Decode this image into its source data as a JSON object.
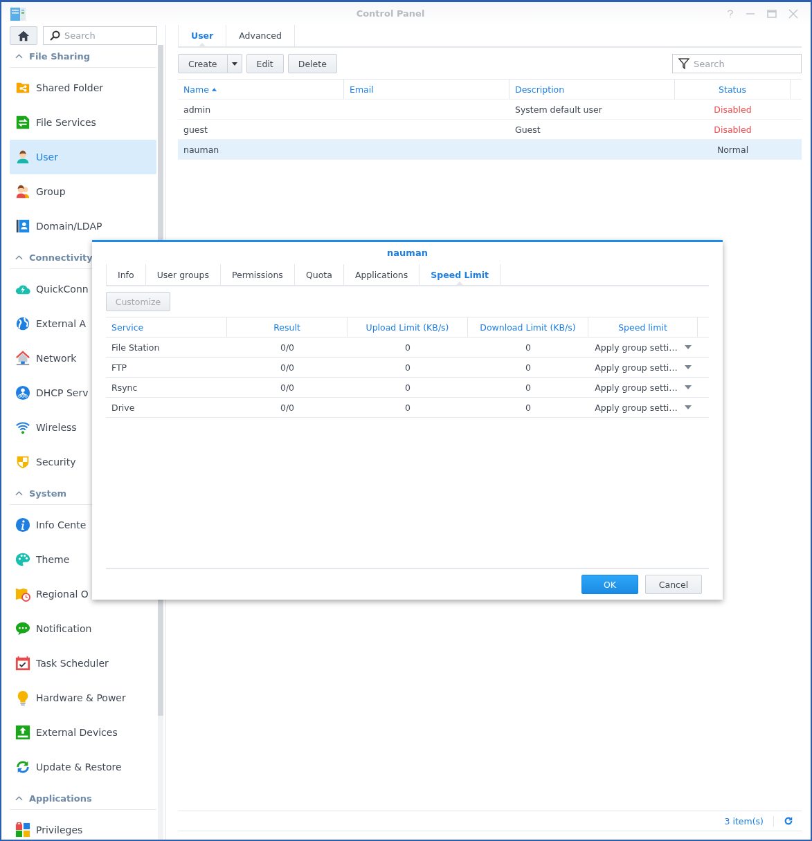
{
  "window": {
    "title": "Control Panel"
  },
  "sidebar": {
    "search": {
      "placeholder": "Search"
    },
    "sections": [
      {
        "title": "File Sharing",
        "expanded": true,
        "items": [
          {
            "label": "Shared Folder",
            "selected": false
          },
          {
            "label": "File Services",
            "selected": false
          },
          {
            "label": "User",
            "selected": true
          },
          {
            "label": "Group",
            "selected": false
          },
          {
            "label": "Domain/LDAP",
            "selected": false
          }
        ]
      },
      {
        "title": "Connectivity",
        "expanded": true,
        "items": [
          {
            "label": "QuickConn",
            "selected": false
          },
          {
            "label": "External A",
            "selected": false
          },
          {
            "label": "Network",
            "selected": false
          },
          {
            "label": "DHCP Serv",
            "selected": false
          },
          {
            "label": "Wireless",
            "selected": false
          },
          {
            "label": "Security",
            "selected": false
          }
        ]
      },
      {
        "title": "System",
        "expanded": true,
        "items": [
          {
            "label": "Info Cente",
            "selected": false
          },
          {
            "label": "Theme",
            "selected": false
          },
          {
            "label": "Regional O",
            "selected": false
          },
          {
            "label": "Notification",
            "selected": false
          },
          {
            "label": "Task Scheduler",
            "selected": false
          },
          {
            "label": "Hardware & Power",
            "selected": false
          },
          {
            "label": "External Devices",
            "selected": false
          },
          {
            "label": "Update & Restore",
            "selected": false
          }
        ]
      },
      {
        "title": "Applications",
        "expanded": true,
        "items": [
          {
            "label": "Privileges",
            "selected": false
          }
        ]
      }
    ]
  },
  "main": {
    "tabs": [
      {
        "label": "User",
        "selected": true
      },
      {
        "label": "Advanced",
        "selected": false
      }
    ],
    "toolbar": {
      "buttons": [
        {
          "label": "Create",
          "kind": "split"
        },
        {
          "label": "Edit",
          "kind": "plain"
        },
        {
          "label": "Delete",
          "kind": "plain"
        }
      ],
      "filter": {
        "placeholder": "Search"
      }
    },
    "table": {
      "columns": [
        {
          "label": "Name",
          "sorted": true
        },
        {
          "label": "Email"
        },
        {
          "label": "Description"
        },
        {
          "label": "Status"
        }
      ],
      "rows": [
        {
          "name": "admin",
          "description": "System default user",
          "status": "Disabled",
          "disabled": true,
          "selected": false
        },
        {
          "name": "guest",
          "description": "Guest",
          "status": "Disabled",
          "disabled": true,
          "selected": false
        },
        {
          "name": "nauman",
          "status": "Normal",
          "disabled": false,
          "selected": true
        }
      ]
    },
    "status_bar": {
      "count": "3 item(s)"
    }
  },
  "dialog": {
    "title": "nauman",
    "tabs": [
      {
        "label": "Info",
        "selected": false
      },
      {
        "label": "User groups",
        "selected": false
      },
      {
        "label": "Permissions",
        "selected": false
      },
      {
        "label": "Quota",
        "selected": false
      },
      {
        "label": "Applications",
        "selected": false
      },
      {
        "label": "Speed Limit",
        "selected": true
      }
    ],
    "customize": {
      "label": "Customize",
      "disabled": true
    },
    "table": {
      "columns": [
        "Service",
        "Result",
        "Upload Limit (KB/s)",
        "Download Limit (KB/s)",
        "Speed limit"
      ],
      "rows": [
        {
          "service": "File Station",
          "result": "0/0",
          "upload": "0",
          "download": "0",
          "speed_limit": "Apply group setti…"
        },
        {
          "service": "FTP",
          "result": "0/0",
          "upload": "0",
          "download": "0",
          "speed_limit": "Apply group setti…"
        },
        {
          "service": "Rsync",
          "result": "0/0",
          "upload": "0",
          "download": "0",
          "speed_limit": "Apply group setti…"
        },
        {
          "service": "Drive",
          "result": "0/0",
          "upload": "0",
          "download": "0",
          "speed_limit": "Apply group setti…"
        }
      ]
    },
    "buttons": [
      {
        "label": "OK",
        "kind": "primary"
      },
      {
        "label": "Cancel",
        "kind": "default"
      }
    ]
  }
}
